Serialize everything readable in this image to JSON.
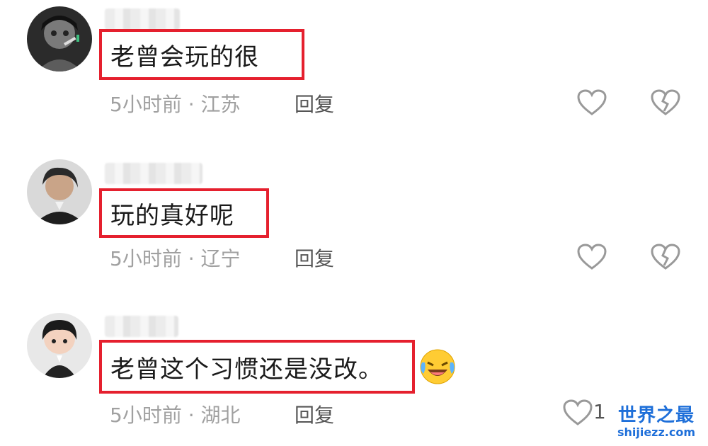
{
  "comments": [
    {
      "text": "老曾会玩的很",
      "meta": "5小时前 · 江苏",
      "reply_label": "回复",
      "like_count": "",
      "avatar_icon": "user-avatar-icon"
    },
    {
      "text": "玩的真好呢",
      "meta": "5小时前 · 辽宁",
      "reply_label": "回复",
      "like_count": "",
      "avatar_icon": "user-avatar-icon"
    },
    {
      "text": "老曾这个习惯还是没改。",
      "meta": "5小时前 · 湖北",
      "reply_label": "回复",
      "like_count": "1",
      "avatar_icon": "user-avatar-icon",
      "emoji": "laughing-crying-emoji"
    }
  ],
  "watermark": {
    "title": "世界之最",
    "url": "shijiezz.com"
  },
  "colors": {
    "highlight_border": "#e5202e",
    "meta_text": "#a0a0a0",
    "watermark": "#1e6fd9"
  }
}
